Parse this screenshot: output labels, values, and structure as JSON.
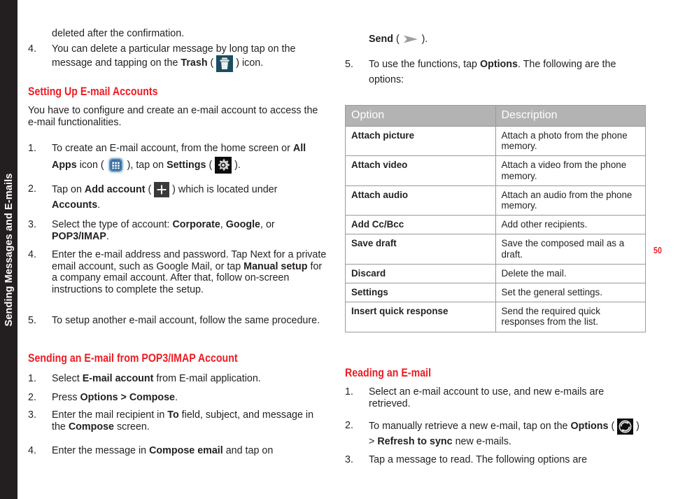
{
  "side_tab": {
    "label": "Sending Messages and E-mails"
  },
  "page_number": "50",
  "colors": {
    "accent_red": "#ed1c24",
    "sidebar_black": "#231f20",
    "table_header_gray": "#b3b3b3",
    "body_text": "#231f20"
  },
  "left_column": {
    "continued_text": "deleted after the confirmation.",
    "item4": {
      "num": "4.",
      "text_a": "You can delete a particular message by long tap on the message and tapping on the ",
      "bold_b": "Trash",
      "text_c": " ( ",
      "icon": "trash-icon",
      "text_d": " ) icon."
    },
    "heading_setting_up": "Setting Up E-mail Accounts",
    "intro_paragraph": "You have to configure and create an e-mail account to access the e-mail functionalities.",
    "setup_steps": [
      {
        "num": "1.",
        "text_a": "To create an E-mail account, from the home screen or ",
        "bold_b": "All Apps",
        "text_c": " icon ( ",
        "icon_a": "all-apps-icon",
        "text_d": " ), tap on ",
        "bold_e": "Settings",
        "text_f": " ( ",
        "icon_b": "settings-gear-icon",
        "text_g": " )."
      },
      {
        "num": "2.",
        "text_a": "Tap on ",
        "bold_b": "Add account",
        "text_c": " ( ",
        "icon_a": "plus-icon",
        "text_d": " ) which is located under ",
        "bold_e": "Accounts",
        "text_f": "."
      },
      {
        "num": "3.",
        "text_a": "Select the type of account: ",
        "bold_b": "Corporate",
        "text_c": ", ",
        "bold_d": "Google",
        "text_e": ", or ",
        "bold_f": "POP3/IMAP",
        "text_g": "."
      },
      {
        "num": "4.",
        "text_a": "Enter the e-mail address and password. Tap Next for a private email account, such as Google Mail, or tap ",
        "bold_b": "Manual setup",
        "text_c": " for a company email account. After that, follow on-screen instructions to complete the setup."
      },
      {
        "num": "5.",
        "text_a": "To setup another e-mail account, follow the same procedure."
      }
    ],
    "heading_sending": "Sending an E-mail from POP3/IMAP Account",
    "sending_steps": [
      {
        "num": "1.",
        "text_a": "Select ",
        "bold_b": "E-mail account",
        "text_c": " from E-mail application."
      },
      {
        "num": "2.",
        "text_a": "Press ",
        "bold_b": "Options > Compose",
        "text_c": "."
      },
      {
        "num": "3.",
        "text_a": "Enter the mail recipient in ",
        "bold_b": "To",
        "text_c": " field, subject, and message in the ",
        "bold_d": "Compose",
        "text_e": " screen."
      },
      {
        "num": "4.",
        "text_a": "Enter the message in ",
        "bold_b": "Compose email",
        "text_c": " and tap on"
      }
    ]
  },
  "right_column": {
    "continued_line": {
      "bold_a": "Send",
      "text_b": " ( ",
      "icon": "send-arrow-icon",
      "text_c": " )."
    },
    "item5": {
      "num": "5.",
      "text_a": "To use the functions, tap ",
      "bold_b": "Options",
      "text_c": ". The following are the options:"
    },
    "options_table": {
      "headers": [
        "Option",
        "Description"
      ],
      "rows": [
        {
          "option": "Attach picture",
          "description": "Attach a photo from the phone memory."
        },
        {
          "option": "Attach video",
          "description": "Attach a video from the phone memory."
        },
        {
          "option": "Attach audio",
          "description": "Attach an audio from the phone memory."
        },
        {
          "option": "Add Cc/Bcc",
          "description": "Add other recipients."
        },
        {
          "option": "Save draft",
          "description": "Save the composed mail as a draft."
        },
        {
          "option": "Discard",
          "description": "Delete the mail."
        },
        {
          "option": "Settings",
          "description": "Set the general settings."
        },
        {
          "option": "Insert quick response",
          "description": "Send the required quick responses from the list."
        }
      ]
    },
    "heading_reading": "Reading an E-mail",
    "reading_steps": [
      {
        "num": "1.",
        "text_a": "Select an e-mail account to use, and new e-mails are retrieved."
      },
      {
        "num": "2.",
        "text_a": "To manually retrieve a new e-mail, tap on the ",
        "bold_b": "Options",
        "text_c": " ( ",
        "icon_a": "refresh-sync-icon",
        "text_d": " ) > ",
        "bold_e": "Refresh to sync",
        "text_f": " new e-mails."
      },
      {
        "num": "3.",
        "text_a": "Tap a message to read. The following options are"
      }
    ]
  }
}
